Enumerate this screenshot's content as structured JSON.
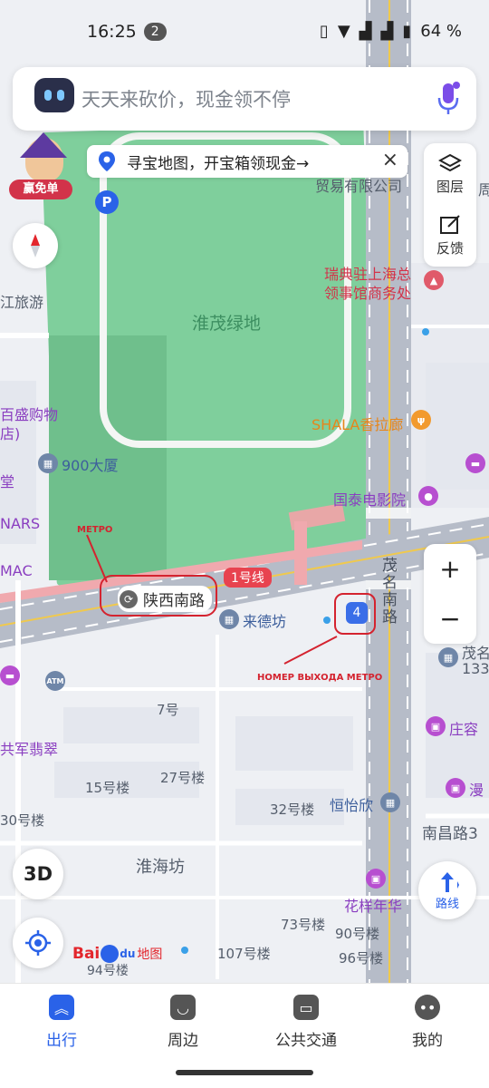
{
  "status_bar": {
    "time": "16:25",
    "notif_count": "2",
    "battery": "64 %"
  },
  "search": {
    "placeholder": "天天来砍价，现金领不停"
  },
  "banner": {
    "text": "寻宝地图，开宝箱领现金→"
  },
  "promo": {
    "tag": "赢免单"
  },
  "right_panel": {
    "layers": "图层",
    "feedback": "反馈"
  },
  "zoom": {
    "in": "+",
    "out": "−"
  },
  "controls": {
    "three_d": "3D",
    "route": "路线"
  },
  "logo": {
    "bai": "Bai",
    "du": "du",
    "map": "地图"
  },
  "map": {
    "park": "淮茂绿地",
    "metro_line": "1号线",
    "metro_station": "陕西南路",
    "exit_number": "4",
    "labels": {
      "trade_co": "贸易有限公司",
      "zhou": "周",
      "river_travel": "江旅游",
      "swedish_consulate_1": "瑞典驻上海总",
      "swedish_consulate_2": "领事馆商务处",
      "baisheng_1": "百盛购物",
      "baisheng_2": "店)",
      "dasha_900": "900大厦",
      "shala": "SHALA香拉廊",
      "tang": "堂",
      "cathay": "国泰电影院",
      "nars": "NARS",
      "mac": "MAC",
      "laidefang": "来德坊",
      "maoming_road": "茂名南路",
      "maoming_133_1": "茂名",
      "maoming_133_2": "133",
      "bldg_7": "7号",
      "gongjun": "共军翡翠",
      "zhuangrong": "庄容",
      "bldg_15": "15号楼",
      "bldg_27": "27号楼",
      "man": "漫",
      "bldg_30": "30号楼",
      "bldg_32": "32号楼",
      "hengyixin": "恒怡欣",
      "nanchang": "南昌路3",
      "huaihaifang": "淮海坊",
      "huayang": "花样年华",
      "bldg_73": "73号楼",
      "bldg_90": "90号楼",
      "bldg_107": "107号楼",
      "bldg_96": "96号楼",
      "bldg_94": "94号楼",
      "atm": "ATM"
    }
  },
  "annotations": {
    "metro": "МЕТРО",
    "exit": "НОМЕР ВЫХОДА МЕТРО"
  },
  "bottom_nav": [
    {
      "label": "出行"
    },
    {
      "label": "周边"
    },
    {
      "label": "公共交通"
    },
    {
      "label": "我的"
    }
  ],
  "colors": {
    "accent": "#2a62e8",
    "park": "#7fcf9c",
    "metro_line": "#e8434f",
    "annotation": "#d4232f"
  }
}
